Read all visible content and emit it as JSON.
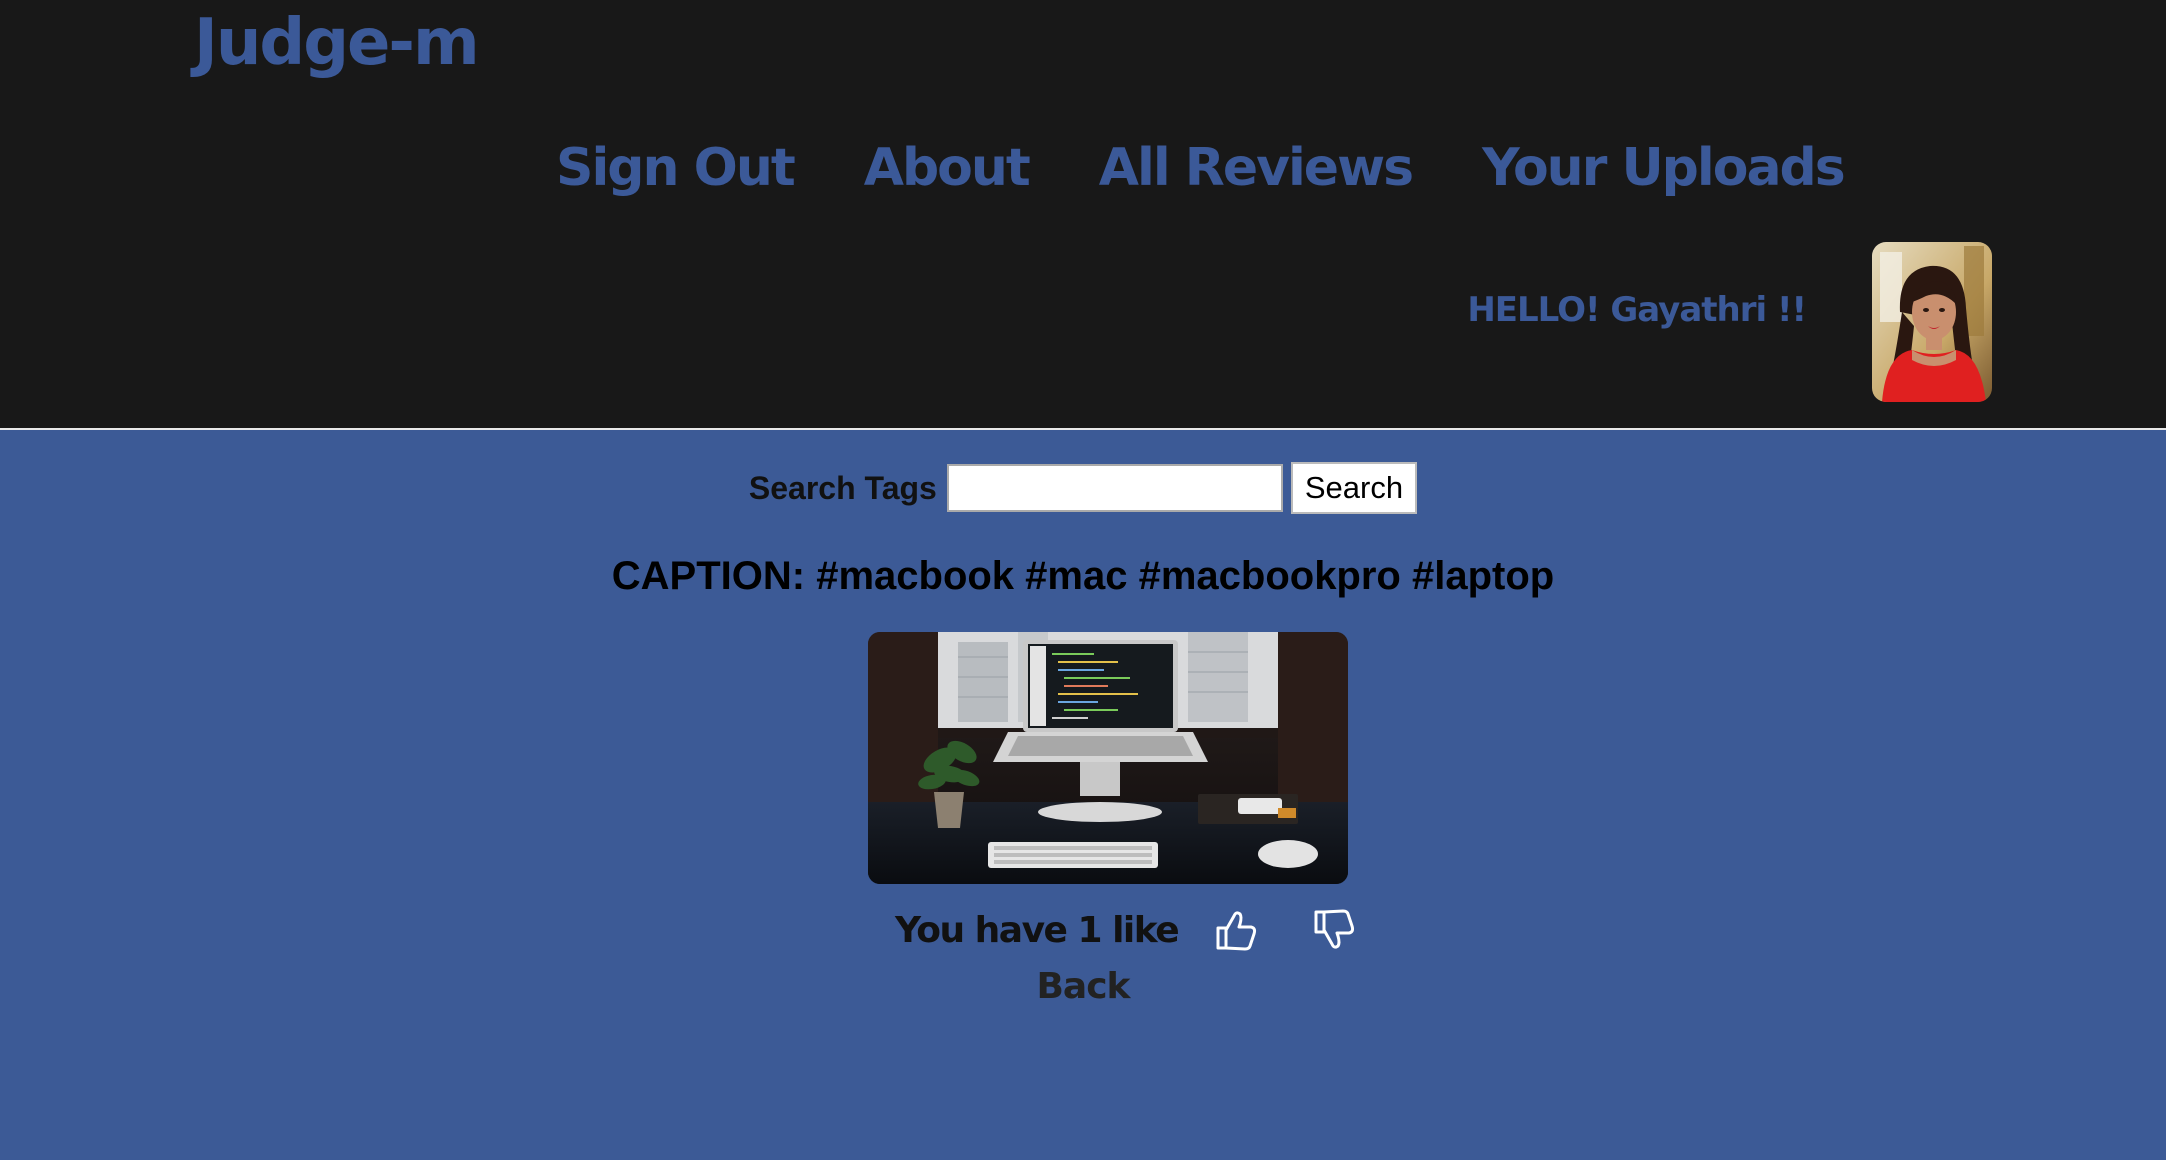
{
  "header": {
    "logo": "Judge-m",
    "nav": {
      "sign_out": "Sign Out",
      "about": "About",
      "all_reviews": "All Reviews",
      "your_uploads": "Your Uploads"
    },
    "greeting": "HELLO! Gayathri !!"
  },
  "search": {
    "label": "Search Tags",
    "value": "",
    "placeholder": "",
    "button_label": "Search"
  },
  "post": {
    "caption": "CAPTION: #macbook #mac #macbookpro #laptop",
    "likes_text": "You have 1 like",
    "like_icon": "thumbs-up-icon",
    "dislike_icon": "thumbs-down-icon",
    "back_label": "Back"
  },
  "colors": {
    "header_bg": "#181818",
    "page_bg": "#3c5a96",
    "brand": "#3b5998"
  }
}
